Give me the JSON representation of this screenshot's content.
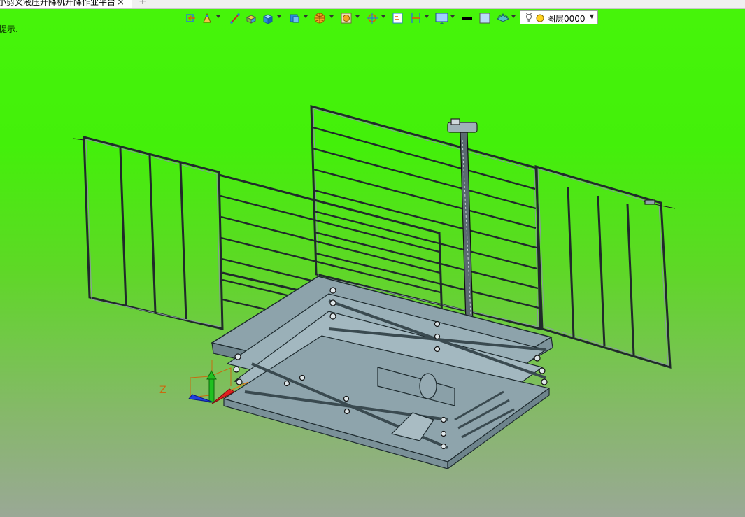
{
  "window": {
    "tab_title": "小剪叉液压升降机升降作业平台",
    "close_glyph": "×",
    "new_tab_glyph": "+"
  },
  "hint": {
    "text": "提示."
  },
  "toolbar": {
    "icons": [
      "exit-sketch-icon",
      "draw-tool-icon",
      "line-icon",
      "extrude-icon",
      "solid-box-icon",
      "shape-icon",
      "globe-icon",
      "view-icon",
      "snap-icon",
      "measure-icon",
      "dimension-icon",
      "display-icon",
      "line-weight-icon",
      "color-icon",
      "layer-material-icon"
    ],
    "layer_selector": {
      "value": "图层0000",
      "bulb_icon": "bulb-icon",
      "dot_color": "#ffd21e"
    }
  },
  "viewport": {
    "background_top": "#46f50a",
    "background_bottom": "#9aa896",
    "model": "scissor-lift-platform-model",
    "axis_label_z": "Z",
    "axis_colors": {
      "x": "#e02020",
      "y": "#20c020",
      "z": "#2040e0"
    }
  }
}
